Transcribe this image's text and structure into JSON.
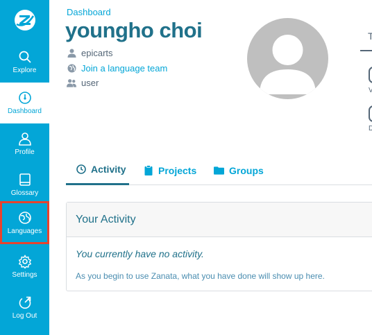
{
  "colors": {
    "sidebar_bg": "#03a6d7",
    "accent": "#03a6d7",
    "title": "#20718a",
    "highlight": "#e8432e"
  },
  "sidebar": {
    "logo_icon": "zanata-logo-icon",
    "items": [
      {
        "label": "Explore",
        "icon": "search-icon",
        "active": false,
        "highlighted": false
      },
      {
        "label": "Dashboard",
        "icon": "dashboard-icon",
        "active": true,
        "highlighted": false
      },
      {
        "label": "Profile",
        "icon": "user-icon",
        "active": false,
        "highlighted": false
      },
      {
        "label": "Glossary",
        "icon": "book-icon",
        "active": false,
        "highlighted": false
      },
      {
        "label": "Languages",
        "icon": "language-icon",
        "active": false,
        "highlighted": true
      },
      {
        "label": "Settings",
        "icon": "gear-icon",
        "active": false,
        "highlighted": false
      },
      {
        "label": "Log Out",
        "icon": "logout-icon",
        "active": false,
        "highlighted": false
      }
    ]
  },
  "header": {
    "breadcrumb": "Dashboard",
    "title": "youngho choi",
    "username": "epicarts",
    "language_team_link": "Join a language team",
    "role": "user"
  },
  "stats_clipped": {
    "tab_initial": "T",
    "small_1": "V",
    "small_2": "D"
  },
  "tabs": [
    {
      "label": "Activity",
      "icon": "clock-icon",
      "active": true
    },
    {
      "label": "Projects",
      "icon": "clipboard-icon",
      "active": false
    },
    {
      "label": "Groups",
      "icon": "folder-icon",
      "active": false
    }
  ],
  "activity": {
    "title": "Your Activity",
    "empty_title": "You currently have no activity.",
    "empty_description": "As you begin to use Zanata, what you have done will show up here."
  }
}
